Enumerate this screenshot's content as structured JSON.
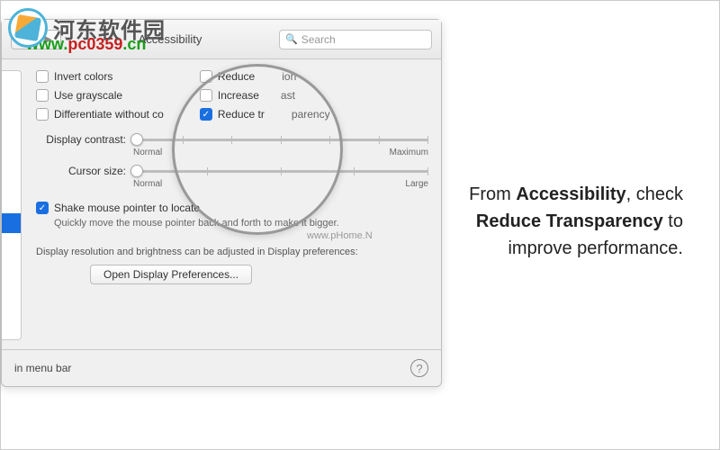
{
  "watermark": {
    "brand": "河东软件园",
    "url_prefix": "www.",
    "url_mid": "pc0359",
    "url_suffix": ".cn",
    "center": "www.pHome.N"
  },
  "titlebar": {
    "title": "Accessibility",
    "search_placeholder": "Search"
  },
  "checkboxes": {
    "invert": "Invert colors",
    "grayscale": "Use grayscale",
    "diff": "Differentiate without co",
    "reduce_motion": "Reduce",
    "reduce_motion_suffix": "ion",
    "increase": "Increase",
    "increase_suffix": "ast",
    "reduce_trans": "Reduce tr",
    "reduce_trans_suffix": "parency"
  },
  "sliders": {
    "contrast_label": "Display contrast:",
    "contrast_min": "Normal",
    "contrast_max": "Maximum",
    "cursor_label": "Cursor size:",
    "cursor_min": "Normal",
    "cursor_max": "Large"
  },
  "shake": {
    "label": "Shake mouse pointer to locate",
    "desc": "Quickly move the mouse pointer back and forth to make it bigger."
  },
  "display": {
    "note": "Display resolution and brightness can be adjusted in Display preferences:",
    "button": "Open Display Preferences..."
  },
  "footer": {
    "menubar": "in menu bar"
  },
  "caption": {
    "l1a": "From ",
    "l1b": "Accessibility",
    "l1c": ", check",
    "l2a": "Reduce Transparency",
    "l2b": " to",
    "l3": "improve performance."
  }
}
